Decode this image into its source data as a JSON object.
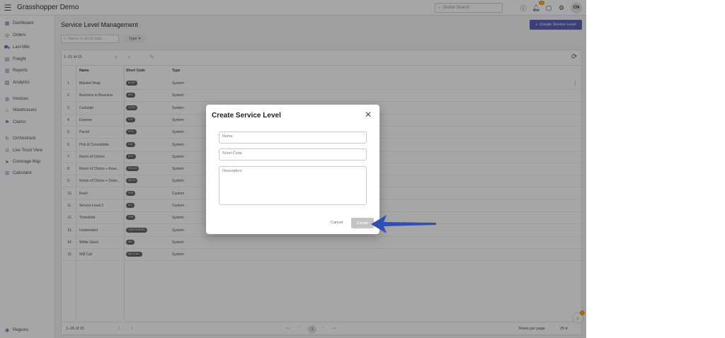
{
  "app": {
    "title": "Grasshopper Demo",
    "search_placeholder": "Global Search",
    "notif_count": "12",
    "user_initials": "CN"
  },
  "sidebar": {
    "items": [
      {
        "label": "Dashboard",
        "icon": "dashboard-icon"
      },
      {
        "label": "Orders",
        "icon": "orders-icon"
      },
      {
        "label": "Last Mile",
        "icon": "truck-icon"
      },
      {
        "label": "Freight",
        "icon": "freight-icon"
      },
      {
        "label": "Reports",
        "icon": "reports-icon"
      },
      {
        "label": "Analytics",
        "icon": "analytics-icon"
      },
      {
        "label": "Invoices",
        "icon": "invoices-icon"
      },
      {
        "label": "Warehouses",
        "icon": "warehouse-icon"
      },
      {
        "label": "Claims",
        "icon": "claims-icon"
      },
      {
        "label": "Orchestrack",
        "icon": "orchestrack-icon"
      },
      {
        "label": "Live Truck View",
        "icon": "live-view-icon"
      },
      {
        "label": "Coverage Map",
        "icon": "map-icon"
      },
      {
        "label": "Calculator",
        "icon": "calculator-icon"
      }
    ],
    "bottom_item": "Regions"
  },
  "page": {
    "title": "Service Level Management",
    "create_button": "Create Service Level",
    "search_placeholder": "Name or short code",
    "type_filter": "Type"
  },
  "table": {
    "range_label": "1–15 of 15",
    "columns": [
      "Name",
      "Short Code",
      "Type"
    ],
    "rows": [
      {
        "num": "1.",
        "name": "Blanket Wrap",
        "code": "BLWR",
        "type": "System"
      },
      {
        "num": "2.",
        "name": "Business to Business",
        "code": "B2B",
        "type": "System"
      },
      {
        "num": "3.",
        "name": "Curbside",
        "code": "CURB",
        "type": "System"
      },
      {
        "num": "4.",
        "name": "Express",
        "code": "EXP",
        "type": "System"
      },
      {
        "num": "5.",
        "name": "Parcel",
        "code": "PRCL",
        "type": "System"
      },
      {
        "num": "6.",
        "name": "Pick & Consolidate",
        "code": "P&C",
        "type": "System"
      },
      {
        "num": "7.",
        "name": "Room of Choice",
        "code": "ROC",
        "type": "System"
      },
      {
        "num": "8.",
        "name": "Room of Choice + Asse...",
        "code": "ROCAS",
        "type": "System"
      },
      {
        "num": "9.",
        "name": "Room of Choice + Debri...",
        "code": "ROCD",
        "type": "System"
      },
      {
        "num": "10.",
        "name": "Rush",
        "code": "RSH",
        "type": "Custom"
      },
      {
        "num": "11.",
        "name": "Service Level 2",
        "code": "SL2",
        "type": "Custom"
      },
      {
        "num": "12.",
        "name": "Threshold",
        "code": "THR",
        "type": "System"
      },
      {
        "num": "13.",
        "name": "Unattended",
        "code": "UNATTENDED",
        "type": "System"
      },
      {
        "num": "14.",
        "name": "White Glove",
        "code": "WG",
        "type": "System"
      },
      {
        "num": "15.",
        "name": "Will Call",
        "code": "WILLCALL",
        "type": "System"
      }
    ],
    "footer_range": "1–15 of 15",
    "page": "1",
    "rows_per_page_label": "Rows per page",
    "rows_per_page_value": "25"
  },
  "modal": {
    "title": "Create Service Level",
    "name_placeholder": "Name",
    "short_code_placeholder": "Short Code",
    "description_placeholder": "Description",
    "cancel": "Cancel",
    "create": "Create"
  },
  "help_badge": "1",
  "colors": {
    "accent": "#5c63b8",
    "arrow": "#2f4fb5",
    "badge": "#f59e0b"
  }
}
